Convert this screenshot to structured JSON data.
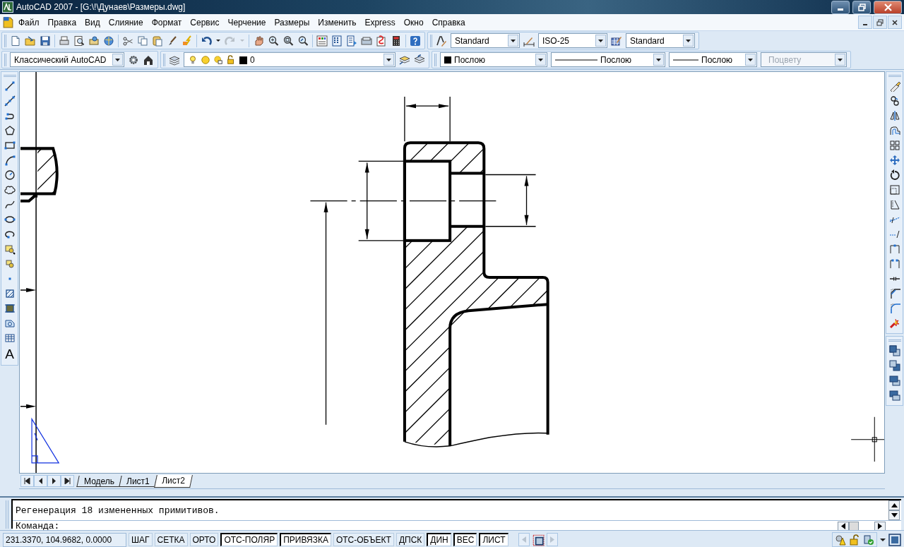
{
  "window": {
    "title": "AutoCAD 2007 - [G:\\!\\Дунаев\\Размеры.dwg]"
  },
  "menu": [
    "Файл",
    "Правка",
    "Вид",
    "Слияние",
    "Формат",
    "Сервис",
    "Черчение",
    "Размеры",
    "Изменить",
    "Express",
    "Окно",
    "Справка"
  ],
  "styles_toolbar": {
    "text_style": "Standard",
    "dimension_style": "ISO-25",
    "table_style": "Standard"
  },
  "workspace": "Классический AutoCAD",
  "layer": "0",
  "properties": {
    "object_color": "Послою",
    "linetype": "Послою",
    "lineweight": "Послою",
    "plot_style": {
      "value": "Поцвету",
      "disabled": true
    }
  },
  "draw_toolbar": {
    "text_tool": "A"
  },
  "layout_tabs": [
    {
      "label": "Модель",
      "selected": false
    },
    {
      "label": "Лист1",
      "selected": false
    },
    {
      "label": "Лист2",
      "selected": true
    }
  ],
  "command_line": {
    "history": "Регенерация 18 измененных примитивов.",
    "prompt": "Команда:"
  },
  "status_bar": {
    "coordinates": "231.3370, 104.9682, 0.0000",
    "toggles": [
      {
        "label": "ШАГ",
        "on": false
      },
      {
        "label": "СЕТКА",
        "on": false
      },
      {
        "label": "ОРТО",
        "on": false
      },
      {
        "label": "ОТС-ПОЛЯР",
        "on": true
      },
      {
        "label": "ПРИВЯЗКА",
        "on": true
      },
      {
        "label": "ОТС-ОБЪЕКТ",
        "on": false
      },
      {
        "label": "ДПСК",
        "on": false
      },
      {
        "label": "ДИН",
        "on": true
      },
      {
        "label": "ВЕС",
        "on": true
      },
      {
        "label": "ЛИСТ",
        "on": true
      }
    ]
  }
}
